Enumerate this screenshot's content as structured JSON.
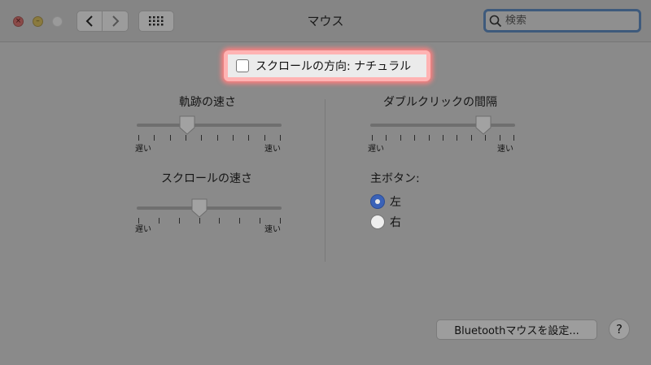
{
  "window": {
    "title": "マウス",
    "search_placeholder": "検索",
    "traffic": {
      "close_glyph": "×",
      "min_glyph": "–"
    }
  },
  "natural_scroll": {
    "label": "スクロールの方向: ナチュラル",
    "checked": false
  },
  "tracking": {
    "label": "軌跡の速さ",
    "min_label": "遅い",
    "max_label": "速い",
    "level": 0.35
  },
  "scroll_speed": {
    "label": "スクロールの速さ",
    "min_label": "遅い",
    "max_label": "速い",
    "level": 0.43
  },
  "double_click": {
    "label": "ダブルクリックの間隔",
    "min_label": "遅い",
    "max_label": "速い",
    "level": 0.78
  },
  "primary_button": {
    "label": "主ボタン:",
    "options": [
      {
        "label": "左",
        "selected": true
      },
      {
        "label": "右",
        "selected": false
      }
    ]
  },
  "footer": {
    "bluetooth_label": "Bluetoothマウスを設定...",
    "help_label": "?"
  }
}
